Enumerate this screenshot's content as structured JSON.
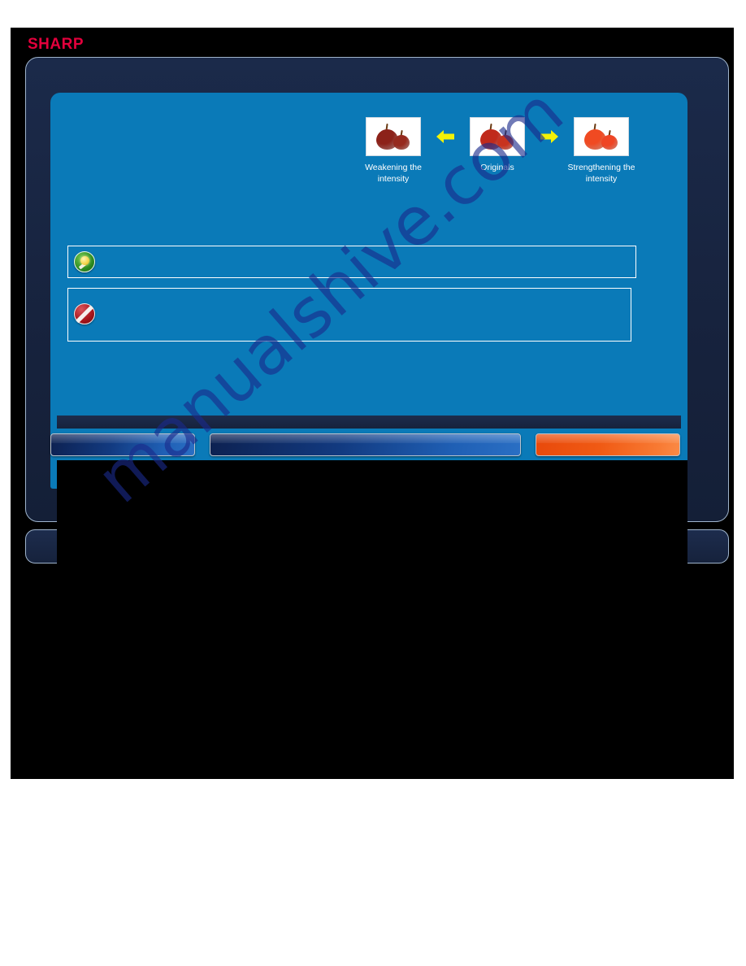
{
  "brand": {
    "logo_text": "SHARP"
  },
  "samples": {
    "items": [
      {
        "caption": "Weakening the intensity",
        "icon": "apple-pair-image",
        "apple_big_color": "#8c2219",
        "apple_small_color": "#962a1e"
      },
      {
        "caption": "Originals",
        "icon": "apple-pair-image",
        "apple_big_color": "#c02a1c",
        "apple_small_color": "#c8331f"
      },
      {
        "caption": "Strengthening the intensity",
        "icon": "apple-pair-image",
        "apple_big_color": "#f04a22",
        "apple_small_color": "#ef4524"
      }
    ],
    "arrows": [
      {
        "direction": "left",
        "icon": "arrow-left-icon",
        "color": "#f2f207"
      },
      {
        "direction": "right",
        "icon": "arrow-right-icon",
        "color": "#f2f207"
      }
    ]
  },
  "notes": [
    {
      "icon": "tip-lightbulb-icon",
      "text": ""
    },
    {
      "icon": "caution-prohibition-icon",
      "text": ""
    }
  ],
  "buttons": [
    {
      "label": "",
      "style": "blue",
      "icon": "hardware-button"
    },
    {
      "label": "",
      "style": "blue",
      "icon": "hardware-button"
    },
    {
      "label": "",
      "style": "orange",
      "icon": "hardware-button"
    }
  ],
  "watermark": {
    "text": "manualshive.com",
    "color": "#1a2a8c"
  },
  "colors": {
    "lcd_blue": "#0a7ab8",
    "frame_navy": "#17233e",
    "brand_red": "#e3003c",
    "accent_orange": "#f05a14",
    "arrow_yellow": "#f2f207"
  }
}
